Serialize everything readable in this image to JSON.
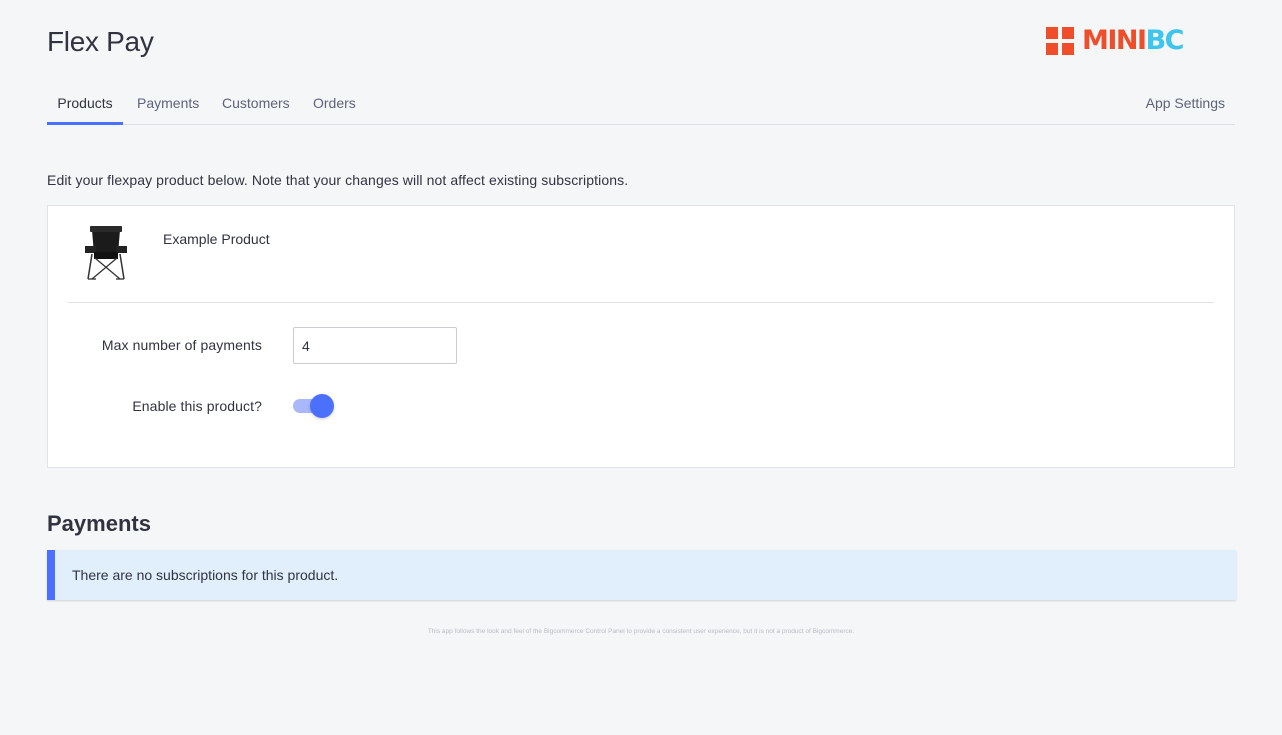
{
  "header": {
    "title": "Flex Pay",
    "logo": {
      "text_primary": "MINI",
      "text_secondary": "BC",
      "color_primary": "#ee4f2a",
      "color_secondary": "#3ec5ee"
    }
  },
  "tabs": [
    {
      "label": "Products",
      "active": true
    },
    {
      "label": "Payments",
      "active": false
    },
    {
      "label": "Customers",
      "active": false
    },
    {
      "label": "Orders",
      "active": false
    }
  ],
  "app_settings_label": "App Settings",
  "intro_text": "Edit your flexpay product below. Note that your changes will not affect existing subscriptions.",
  "product": {
    "name": "Example Product",
    "image_icon": "folding-chair-icon",
    "max_payments_label": "Max number of payments",
    "max_payments_value": "4",
    "enable_label": "Enable this product?",
    "enabled": true
  },
  "payments": {
    "title": "Payments",
    "empty_message": "There are no subscriptions for this product."
  },
  "footer_note": "This app follows the look and feel of the Bigcommerce Control Panel to provide a consistent user experience, but it is not a product of Bigcommerce.",
  "colors": {
    "accent": "#4b71fc",
    "alert_background": "#e1eefb",
    "page_background": "#f5f6f8"
  }
}
